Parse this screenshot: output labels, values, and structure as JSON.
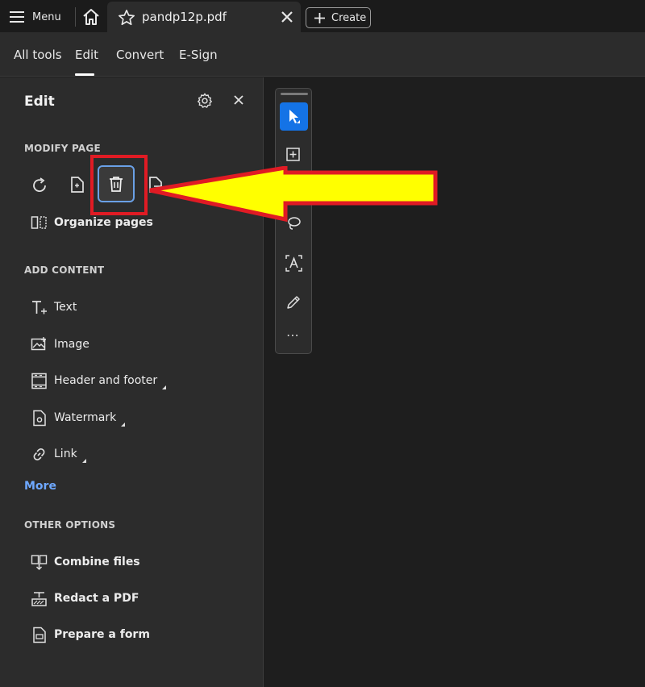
{
  "titlebar": {
    "menu_label": "Menu",
    "tab_title": "pandp12p.pdf",
    "create_label": "Create"
  },
  "nav": {
    "items": [
      "All tools",
      "Edit",
      "Convert",
      "E-Sign"
    ],
    "active": "Edit"
  },
  "panel": {
    "title": "Edit",
    "modify_page": {
      "label": "MODIFY PAGE",
      "icons": [
        "rotate-icon",
        "insert-page-icon",
        "delete-page-icon",
        "extract-page-icon"
      ],
      "organize_label": "Organize pages"
    },
    "add_content": {
      "label": "ADD CONTENT",
      "items": [
        "Text",
        "Image",
        "Header and footer",
        "Watermark",
        "Link"
      ],
      "more_label": "More"
    },
    "other_options": {
      "label": "OTHER OPTIONS",
      "items": [
        "Combine files",
        "Redact a PDF",
        "Prepare a form"
      ]
    }
  },
  "toolbar": {
    "tools": [
      "select-icon",
      "add-comment-icon",
      "lasso-icon",
      "text-recognition-icon",
      "draw-icon"
    ],
    "more_label": "⋯"
  },
  "colors": {
    "accent": "#1473e6",
    "link": "#6ea8ff",
    "annotation_red": "#e01b24",
    "annotation_yellow": "#ffff00"
  }
}
